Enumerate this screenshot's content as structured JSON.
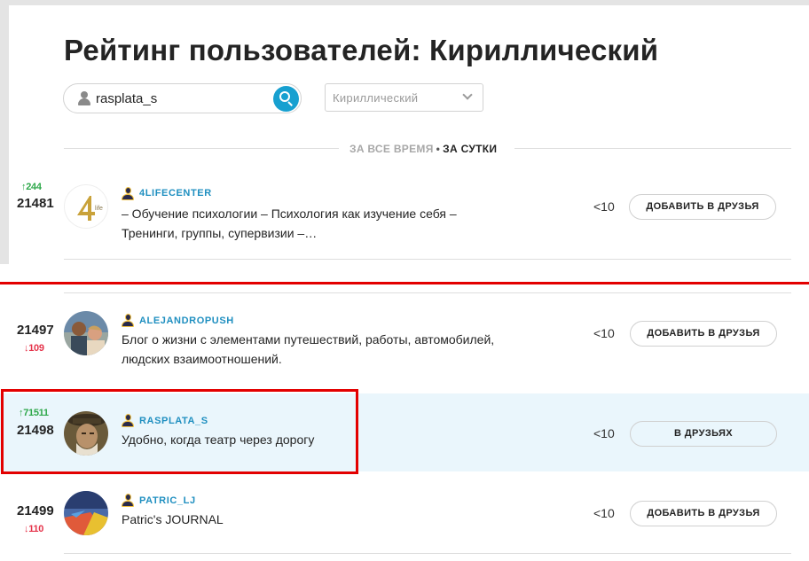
{
  "page": {
    "title": "Рейтинг пользователей: Кириллический"
  },
  "search": {
    "value": "rasplata_s"
  },
  "filter": {
    "selected": "Кириллический"
  },
  "period": {
    "all_time": "ЗА ВСЕ ВРЕМЯ",
    "separator": "•",
    "day": "ЗА СУТКИ"
  },
  "users": [
    {
      "delta": "↑244",
      "delta_dir": "up",
      "rank": "21481",
      "username": "4LIFECENTER",
      "description": "– Обучение психологии – Психология как изучение себя – Тренинги, группы, супервизии –…",
      "friends": "<10",
      "button": "ДОБАВИТЬ В ДРУЗЬЯ"
    },
    {
      "delta": "↓109",
      "delta_dir": "down",
      "rank": "21497",
      "username": "ALEJANDROPUSH",
      "description": "Блог о жизни с элементами путешествий, работы, автомобилей, людских взаимоотношений.",
      "friends": "<10",
      "button": "ДОБАВИТЬ В ДРУЗЬЯ"
    },
    {
      "delta": "↑71511",
      "delta_dir": "up",
      "rank": "21498",
      "username": "RASPLATA_S",
      "description": "Удобно, когда театр через дорогу",
      "friends": "<10",
      "button": "В ДРУЗЬЯХ"
    },
    {
      "delta": "↓110",
      "delta_dir": "down",
      "rank": "21499",
      "username": "PATRIC_LJ",
      "description": "Patric's JOURNAL",
      "friends": "<10",
      "button": "ДОБАВИТЬ В ДРУЗЬЯ"
    }
  ],
  "colors": {
    "accent": "#17a0d0",
    "up": "#2ea84a",
    "down": "#e5334a",
    "highlight": "#eaf6fc",
    "annotation_red": "#e30000"
  }
}
